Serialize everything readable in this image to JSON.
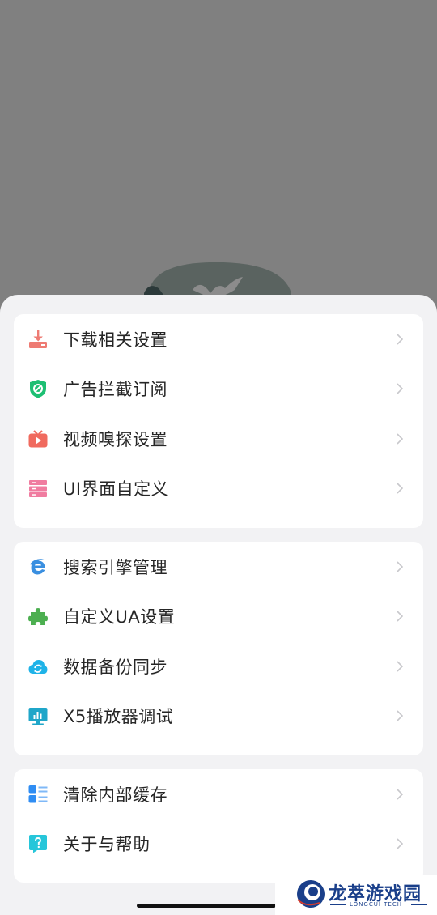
{
  "menu": {
    "group1": [
      {
        "label": "下载相关设置",
        "icon": "download-icon"
      },
      {
        "label": "广告拦截订阅",
        "icon": "ad-block-shield-icon"
      },
      {
        "label": "视频嗅探设置",
        "icon": "video-tv-icon"
      },
      {
        "label": "UI界面自定义",
        "icon": "ui-layout-icon"
      }
    ],
    "group2": [
      {
        "label": "搜索引擎管理",
        "icon": "search-engine-e-icon"
      },
      {
        "label": "自定义UA设置",
        "icon": "puzzle-piece-icon"
      },
      {
        "label": "数据备份同步",
        "icon": "cloud-sync-icon"
      },
      {
        "label": "X5播放器调试",
        "icon": "player-monitor-icon"
      }
    ],
    "group3": [
      {
        "label": "清除内部缓存",
        "icon": "clear-cache-list-icon"
      },
      {
        "label": "关于与帮助",
        "icon": "help-question-icon"
      }
    ]
  },
  "watermark": {
    "title": "龙萃游戏园",
    "subtitle": "LONGCUI TECH"
  },
  "colors": {
    "overlay": "#808080",
    "sheet_bg": "#f2f2f4",
    "card_bg": "#ffffff",
    "text": "#262626",
    "chevron": "#c8c8cc"
  }
}
